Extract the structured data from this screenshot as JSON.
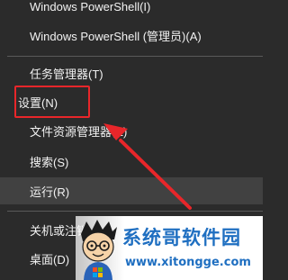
{
  "menu": {
    "items": [
      {
        "label": "Windows PowerShell(I)"
      },
      {
        "label": "Windows PowerShell (管理员)(A)"
      },
      {
        "label": "任务管理器(T)"
      },
      {
        "label": "设置(N)"
      },
      {
        "label": "文件资源管理器(E)"
      },
      {
        "label": "搜索(S)"
      },
      {
        "label": "运行(R)"
      },
      {
        "label": "关机或注销"
      },
      {
        "label": "桌面(D)"
      }
    ]
  },
  "annotation": {
    "color": "#e8262a"
  },
  "watermark": {
    "title": "系统哥软件园",
    "url": "www.xitongge.com",
    "color": "#1f6fc1"
  }
}
